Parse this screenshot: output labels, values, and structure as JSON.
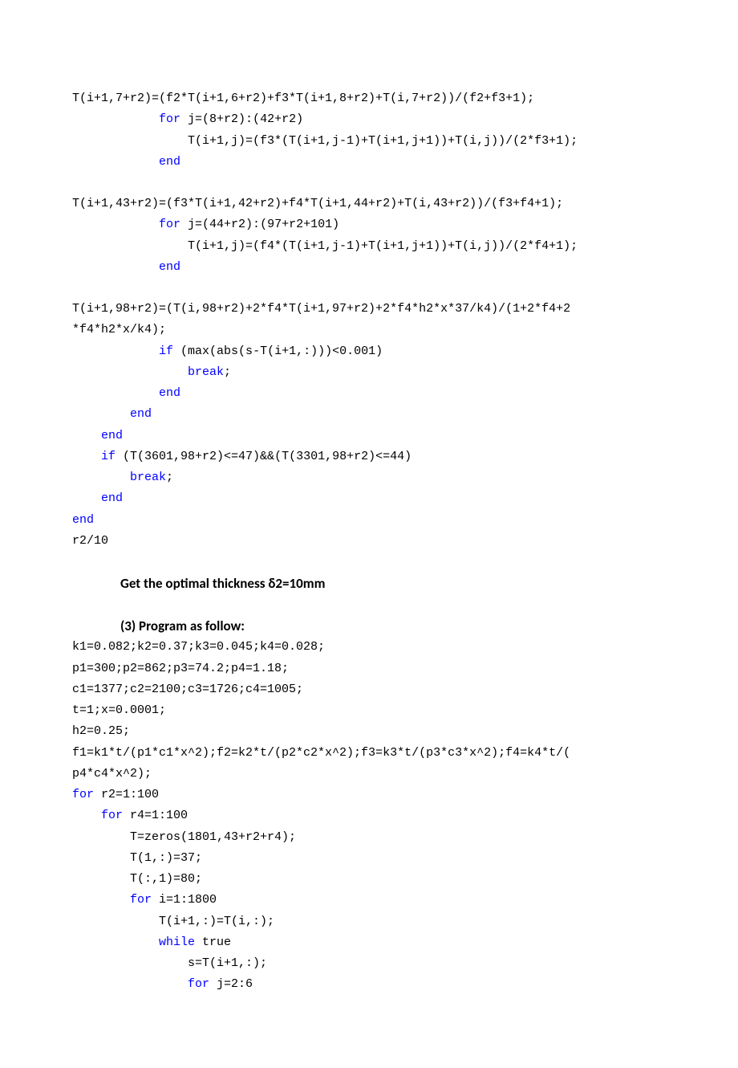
{
  "lines": [
    {
      "type": "code",
      "segments": [
        {
          "t": "T(i+1,7+r2)=(f2*T(i+1,6+r2)+f3*T(i+1,8+r2)+T(i,7+r2))/(f2+f3+1);"
        }
      ]
    },
    {
      "type": "code",
      "segments": [
        {
          "t": "            "
        },
        {
          "t": "for",
          "c": "kw"
        },
        {
          "t": " j=(8+r2):(42+r2)"
        }
      ]
    },
    {
      "type": "code",
      "segments": [
        {
          "t": "                T(i+1,j)=(f3*(T(i+1,j-1)+T(i+1,j+1))+T(i,j))/(2*f3+1);"
        }
      ]
    },
    {
      "type": "code",
      "segments": [
        {
          "t": "            "
        },
        {
          "t": "end",
          "c": "kw"
        }
      ]
    },
    {
      "type": "blank"
    },
    {
      "type": "code",
      "segments": [
        {
          "t": "T(i+1,43+r2)=(f3*T(i+1,42+r2)+f4*T(i+1,44+r2)+T(i,43+r2))/(f3+f4+1);"
        }
      ]
    },
    {
      "type": "code",
      "segments": [
        {
          "t": "            "
        },
        {
          "t": "for",
          "c": "kw"
        },
        {
          "t": " j=(44+r2):(97+r2+101)"
        }
      ]
    },
    {
      "type": "code",
      "segments": [
        {
          "t": "                T(i+1,j)=(f4*(T(i+1,j-1)+T(i+1,j+1))+T(i,j))/(2*f4+1);"
        }
      ]
    },
    {
      "type": "code",
      "segments": [
        {
          "t": "            "
        },
        {
          "t": "end",
          "c": "kw"
        }
      ]
    },
    {
      "type": "blank"
    },
    {
      "type": "code",
      "segments": [
        {
          "t": "T(i+1,98+r2)=(T(i,98+r2)+2*f4*T(i+1,97+r2)+2*f4*h2*x*37/k4)/(1+2*f4+2"
        }
      ]
    },
    {
      "type": "code",
      "segments": [
        {
          "t": "*f4*h2*x/k4);"
        }
      ]
    },
    {
      "type": "code",
      "segments": [
        {
          "t": "            "
        },
        {
          "t": "if",
          "c": "kw"
        },
        {
          "t": " (max(abs(s-T(i+1,:)))<0.001)"
        }
      ]
    },
    {
      "type": "code",
      "segments": [
        {
          "t": "                "
        },
        {
          "t": "break",
          "c": "kw"
        },
        {
          "t": ";"
        }
      ]
    },
    {
      "type": "code",
      "segments": [
        {
          "t": "            "
        },
        {
          "t": "end",
          "c": "kw"
        }
      ]
    },
    {
      "type": "code",
      "segments": [
        {
          "t": "        "
        },
        {
          "t": "end",
          "c": "kw"
        }
      ]
    },
    {
      "type": "code",
      "segments": [
        {
          "t": "    "
        },
        {
          "t": "end",
          "c": "kw"
        }
      ]
    },
    {
      "type": "code",
      "segments": [
        {
          "t": "    "
        },
        {
          "t": "if",
          "c": "kw"
        },
        {
          "t": " (T(3601,98+r2)<=47)&&(T(3301,98+r2)<=44)"
        }
      ]
    },
    {
      "type": "code",
      "segments": [
        {
          "t": "        "
        },
        {
          "t": "break",
          "c": "kw"
        },
        {
          "t": ";"
        }
      ]
    },
    {
      "type": "code",
      "segments": [
        {
          "t": "    "
        },
        {
          "t": "end",
          "c": "kw"
        }
      ]
    },
    {
      "type": "code",
      "segments": [
        {
          "t": "end",
          "c": "kw"
        }
      ]
    },
    {
      "type": "code",
      "segments": [
        {
          "t": "r2/10"
        }
      ]
    },
    {
      "type": "blank"
    },
    {
      "type": "prose",
      "text": "Get the optimal thickness δ2=10mm"
    },
    {
      "type": "blank"
    },
    {
      "type": "prose",
      "text": "(3) Program as follow:"
    },
    {
      "type": "code",
      "segments": [
        {
          "t": "k1=0.082;k2=0.37;k3=0.045;k4=0.028;"
        }
      ]
    },
    {
      "type": "code",
      "segments": [
        {
          "t": "p1=300;p2=862;p3=74.2;p4=1.18;"
        }
      ]
    },
    {
      "type": "code",
      "segments": [
        {
          "t": "c1=1377;c2=2100;c3=1726;c4=1005;"
        }
      ]
    },
    {
      "type": "code",
      "segments": [
        {
          "t": "t=1;x=0.0001;"
        }
      ]
    },
    {
      "type": "code",
      "segments": [
        {
          "t": "h2=0.25;"
        }
      ]
    },
    {
      "type": "code",
      "segments": [
        {
          "t": "f1=k1*t/(p1*c1*x^2);f2=k2*t/(p2*c2*x^2);f3=k3*t/(p3*c3*x^2);f4=k4*t/("
        }
      ]
    },
    {
      "type": "code",
      "segments": [
        {
          "t": "p4*c4*x^2);"
        }
      ]
    },
    {
      "type": "code",
      "segments": [
        {
          "t": "for",
          "c": "kw"
        },
        {
          "t": " r2=1:100"
        }
      ]
    },
    {
      "type": "code",
      "segments": [
        {
          "t": "    "
        },
        {
          "t": "for",
          "c": "kw"
        },
        {
          "t": " r4=1:100"
        }
      ]
    },
    {
      "type": "code",
      "segments": [
        {
          "t": "        T=zeros(1801,43+r2+r4);"
        }
      ]
    },
    {
      "type": "code",
      "segments": [
        {
          "t": "        T(1,:)=37;"
        }
      ]
    },
    {
      "type": "code",
      "segments": [
        {
          "t": "        T(:,1)=80;"
        }
      ]
    },
    {
      "type": "code",
      "segments": [
        {
          "t": "        "
        },
        {
          "t": "for",
          "c": "kw"
        },
        {
          "t": " i=1:1800"
        }
      ]
    },
    {
      "type": "code",
      "segments": [
        {
          "t": "            T(i+1,:)=T(i,:);"
        }
      ]
    },
    {
      "type": "code",
      "segments": [
        {
          "t": "            "
        },
        {
          "t": "while",
          "c": "kw"
        },
        {
          "t": " true"
        }
      ]
    },
    {
      "type": "code",
      "segments": [
        {
          "t": "                s=T(i+1,:);"
        }
      ]
    },
    {
      "type": "code",
      "segments": [
        {
          "t": "                "
        },
        {
          "t": "for",
          "c": "kw"
        },
        {
          "t": " j=2:6"
        }
      ]
    }
  ]
}
